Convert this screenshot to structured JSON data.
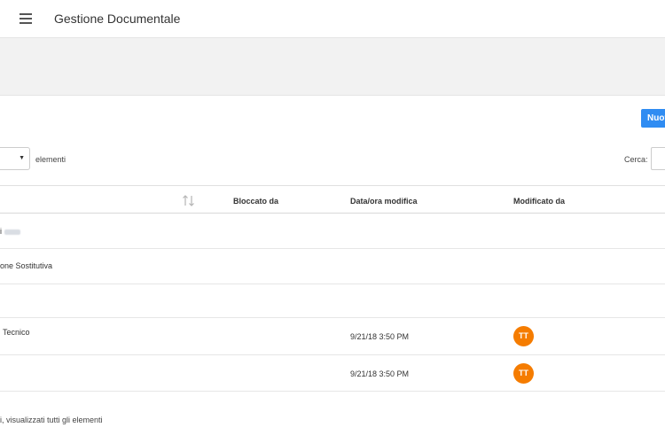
{
  "header": {
    "title": "Gestione Documentale",
    "menu_icon": "hamburger-menu-icon"
  },
  "toolbar": {
    "new_label": "Nuovo"
  },
  "controls": {
    "page_size_value": "",
    "page_size_label": "elementi",
    "search_label": "Cerca:",
    "search_value": ""
  },
  "table": {
    "columns": [
      "",
      "Bloccato da",
      "Data/ora modifica",
      "Modificato da"
    ],
    "rows": [
      {
        "name": "i",
        "blurred": true,
        "date": "",
        "modified_by": ""
      },
      {
        "name": "one Sostitutiva",
        "blurred": false,
        "date": "",
        "modified_by": ""
      },
      {
        "name": "",
        "blurred": false,
        "date": "",
        "modified_by": ""
      },
      {
        "name": "Tecnico",
        "blurred": false,
        "date": "9/21/18 3:50 PM",
        "modified_by": "TT"
      },
      {
        "name": "",
        "blurred": false,
        "date": "9/21/18 3:50 PM",
        "modified_by": "TT"
      }
    ]
  },
  "footer": {
    "text": "i, visualizzati tutti gli elementi"
  },
  "colors": {
    "primary": "#2f8cf2",
    "avatar": "#f57c00",
    "band": "#f2f2f2"
  }
}
